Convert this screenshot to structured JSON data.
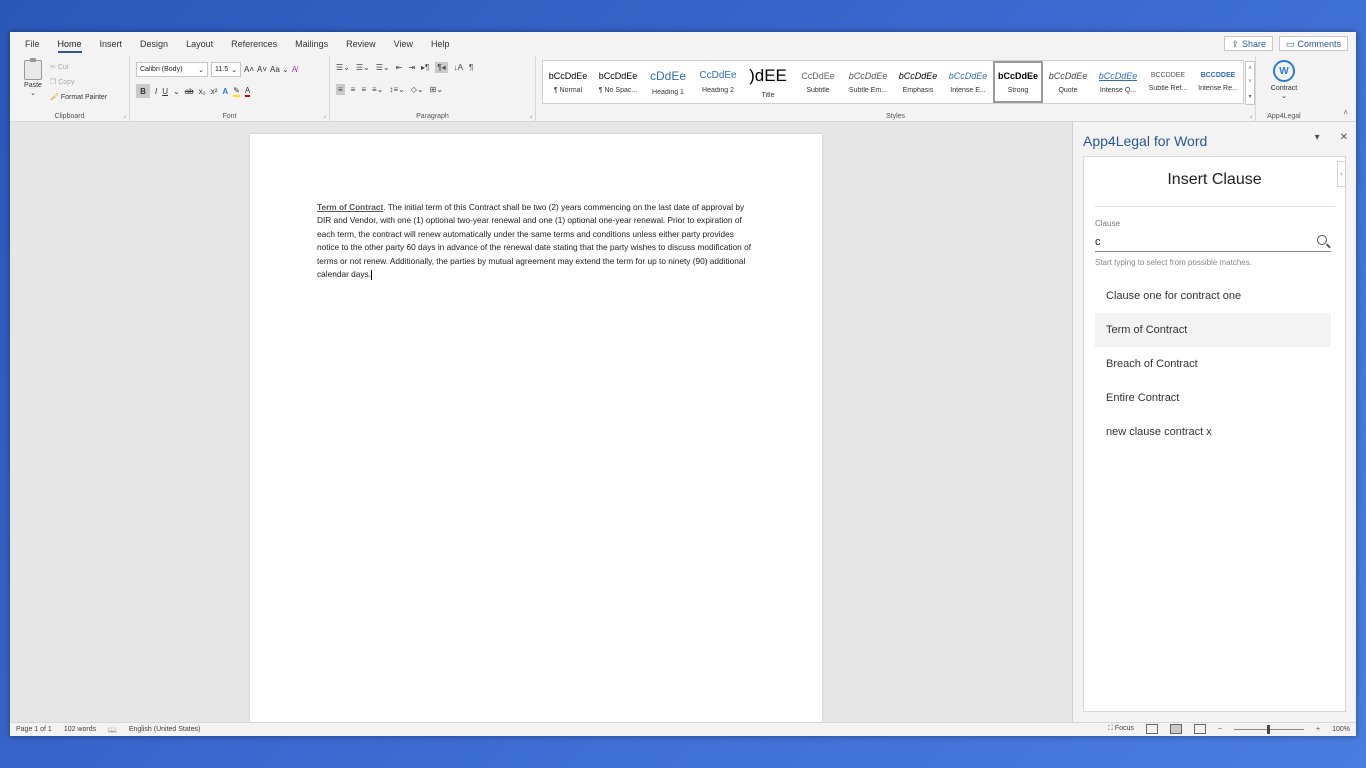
{
  "menu": {
    "tabs": [
      "File",
      "Home",
      "Insert",
      "Design",
      "Layout",
      "References",
      "Mailings",
      "Review",
      "View",
      "Help"
    ],
    "share": "Share",
    "comments": "Comments"
  },
  "ribbon": {
    "clipboard": {
      "label": "Clipboard",
      "paste": "Paste",
      "cut": "Cut",
      "copy": "Copy",
      "format_painter": "Format Painter"
    },
    "font": {
      "label": "Font",
      "family": "Calibri (Body)",
      "size": "11.5",
      "case": "Aa"
    },
    "paragraph": {
      "label": "Paragraph"
    },
    "styles": {
      "label": "Styles",
      "items": [
        {
          "preview": "bCcDdEe",
          "name": "¶ Normal"
        },
        {
          "preview": "bCcDdEe",
          "name": "¶ No Spac..."
        },
        {
          "preview": "cDdEe",
          "name": "Heading 1"
        },
        {
          "preview": "CcDdEe",
          "name": "Heading 2"
        },
        {
          "preview": ")dEE",
          "name": "Title"
        },
        {
          "preview": "CcDdEe",
          "name": "Subtitle"
        },
        {
          "preview": "bCcDdEe",
          "name": "Subtle Em..."
        },
        {
          "preview": "bCcDdEe",
          "name": "Emphasis"
        },
        {
          "preview": "bCcDdEe",
          "name": "Intense E..."
        },
        {
          "preview": "bCcDdEe",
          "name": "Strong"
        },
        {
          "preview": "bCcDdEe",
          "name": "Quote"
        },
        {
          "preview": "bCcDdEe",
          "name": "Intense Q..."
        },
        {
          "preview": "BCCDDEE",
          "name": "Subtle Ref..."
        },
        {
          "preview": "BCCDDEE",
          "name": "Intense Re..."
        }
      ]
    },
    "app": {
      "label": "App4Legal",
      "button": "Contract"
    }
  },
  "document": {
    "heading": "Term of Contract",
    "body": ". The initial term of this Contract shall be two (2) years commencing on the last date of approval by DIR and Vendor, with one (1) optional two-year renewal and one (1) optional one-year renewal. Prior to expiration of each term, the contract will renew automatically under the same terms and conditions unless either party provides notice to the other party 60 days in advance of the renewal date stating that the party wishes to discuss modification of terms or not renew. Additionally, the parties by mutual agreement may extend the term for up to ninety (90) additional calendar days."
  },
  "pane": {
    "title": "App4Legal for Word",
    "insert_title": "Insert Clause",
    "field_label": "Clause",
    "field_value": "c",
    "hint": "Start typing to select from possible matches.",
    "clauses": [
      "Clause one for contract one",
      "Term of Contract",
      "Breach of Contract",
      "Entire Contract",
      "new clause contract x"
    ]
  },
  "status": {
    "page": "Page 1 of 1",
    "words": "102 words",
    "language": "English (United States)",
    "focus": "Focus",
    "zoom": "100%"
  },
  "colors": {
    "accent": "#2b579a",
    "logo": "#2b7cd3"
  }
}
